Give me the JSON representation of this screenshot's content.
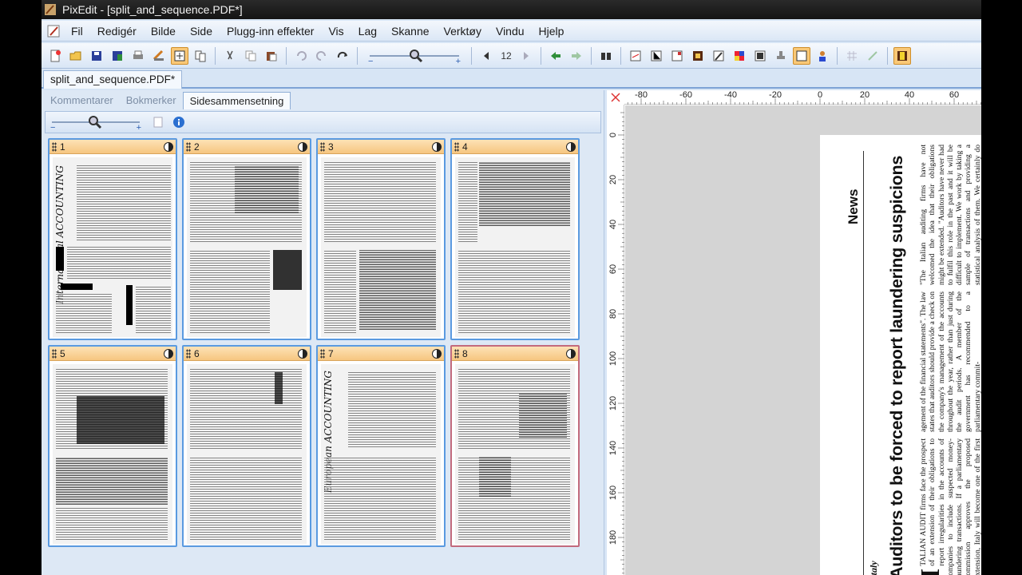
{
  "window": {
    "title": "PixEdit - [split_and_sequence.PDF*]"
  },
  "menu": {
    "items": [
      "Fil",
      "Redigér",
      "Bilde",
      "Side",
      "Plugg-inn effekter",
      "Vis",
      "Lag",
      "Skanne",
      "Verktøy",
      "Vindu",
      "Hjelp"
    ],
    "active_index": 3
  },
  "toolbar": {
    "page_number": "12"
  },
  "document_tab": {
    "label": "split_and_sequence.PDF*"
  },
  "panel": {
    "tabs": [
      "Kommentarer",
      "Bokmerker",
      "Sidesammensetning"
    ],
    "selected_tab": 2
  },
  "thumbnails": [
    {
      "label": "1"
    },
    {
      "label": "2"
    },
    {
      "label": "3"
    },
    {
      "label": "4"
    },
    {
      "label": "5"
    },
    {
      "label": "6"
    },
    {
      "label": "7"
    },
    {
      "label": "8"
    }
  ],
  "thumbnail_titles": {
    "t1": "International ACCOUNTING",
    "t7": "European ACCOUNTING"
  },
  "current_page": "8",
  "ruler": {
    "h_labels": [
      "-80",
      "-60",
      "-40",
      "-20",
      "0",
      "20",
      "40",
      "60"
    ],
    "v_labels": [
      "0",
      "20",
      "40",
      "60",
      "80",
      "100",
      "120",
      "140",
      "160",
      "180"
    ]
  },
  "article": {
    "section": "News",
    "country": "Italy",
    "headline": "Auditors to be forced to report laundering suspicions",
    "col1_dropcap": "I",
    "col1": "TALIAN AUDIT firms face the prospect of an extension of their obligations to report irregularities in the accounts of companies to include suspected money-laundering transactions. If a parliamentary commission approves the proposed extension, Italy will become one of the first countries to im-",
    "col2": "agement of the financial statements\". The law states that auditors should provide a check on the company's management of the accounts throughout the year, rather than just during the audit periods. A member of the government has recommended to a parliamentary commit-",
    "col3": "\"The Italian auditing firms have not welcomed the idea that their obligations might be extended. \"Auditors have never had to fulfil this role in the past and it will be difficult to implement. We work by taking a sample of transactions and providing a statistical analysis of them. We certainly do not"
  },
  "colors": {
    "accent": "#f6c680",
    "selection_border": "#5a9ae0",
    "current_border": "#c26a7d"
  }
}
